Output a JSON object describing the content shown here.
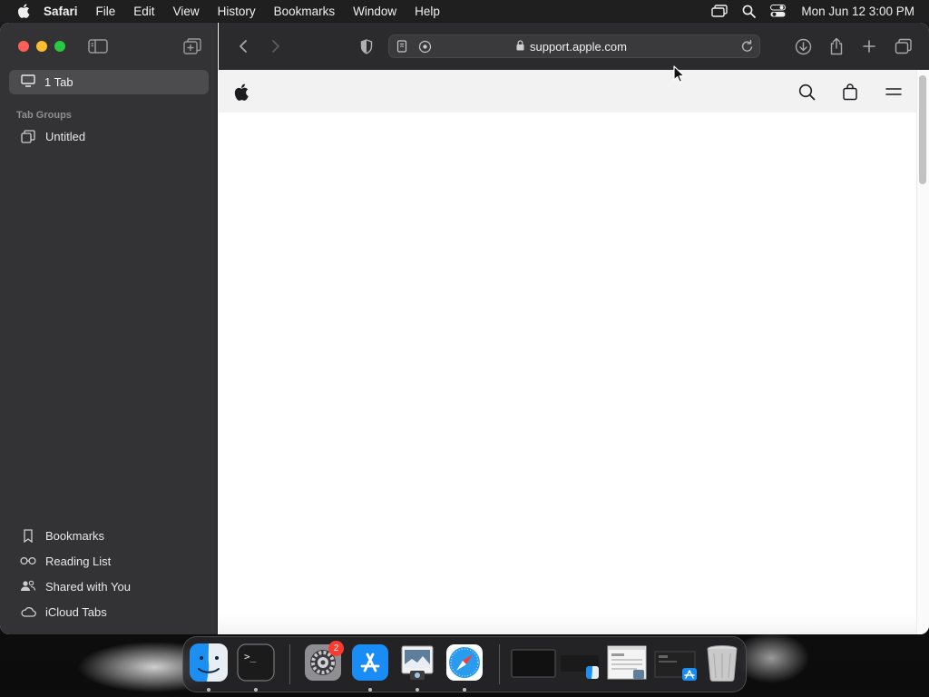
{
  "menubar": {
    "app_name": "Safari",
    "menus": [
      "File",
      "Edit",
      "View",
      "History",
      "Bookmarks",
      "Window",
      "Help"
    ],
    "clock": "Mon Jun 12  3:00 PM"
  },
  "sidebar": {
    "tab_count_label": "1 Tab",
    "tab_groups_label": "Tab Groups",
    "groups": [
      {
        "label": "Untitled"
      }
    ],
    "bottom_items": [
      {
        "label": "Bookmarks",
        "icon": "bookmark-icon"
      },
      {
        "label": "Reading List",
        "icon": "glasses-icon"
      },
      {
        "label": "Shared with You",
        "icon": "shared-people-icon"
      },
      {
        "label": "iCloud Tabs",
        "icon": "cloud-icon"
      }
    ]
  },
  "toolbar": {
    "url": "support.apple.com"
  },
  "dock": {
    "items": [
      {
        "name": "finder",
        "icon": "finder-icon",
        "running": true
      },
      {
        "name": "terminal",
        "icon": "terminal-icon",
        "running": true
      },
      {
        "name": "system-settings",
        "icon": "gear-icon",
        "running": false,
        "badge": "2"
      },
      {
        "name": "app-store",
        "icon": "app-store-icon",
        "running": true
      },
      {
        "name": "preview",
        "icon": "preview-icon",
        "running": true
      },
      {
        "name": "safari",
        "icon": "compass-icon",
        "running": true
      },
      {
        "name": "minimized-window-1",
        "icon": "window-thumbnail-icon",
        "running": false
      },
      {
        "name": "minimized-window-2",
        "icon": "window-thumbnail-icon",
        "running": false
      },
      {
        "name": "minimized-window-3",
        "icon": "window-thumbnail-icon",
        "running": false
      },
      {
        "name": "minimized-window-4",
        "icon": "window-thumbnail-icon",
        "running": false
      },
      {
        "name": "trash",
        "icon": "trash-icon",
        "running": false
      }
    ]
  },
  "colors": {
    "traffic_red": "#fe5f57",
    "traffic_yellow": "#febc2e",
    "traffic_green": "#28c840",
    "badge_red": "#ff3b30"
  }
}
